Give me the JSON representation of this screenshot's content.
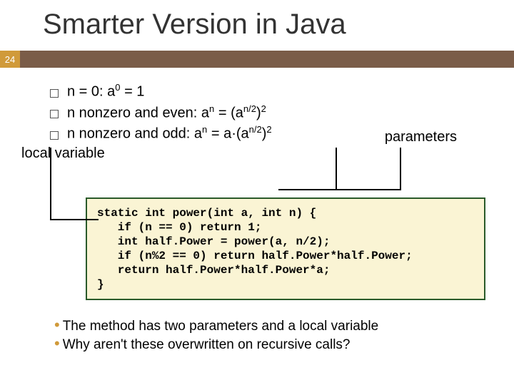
{
  "title": "Smarter Version in Java",
  "page_number": "24",
  "bullets": {
    "b1_pre": "n = 0:  a",
    "b1_sup": "0",
    "b1_post": " = 1",
    "b2_pre": "n nonzero and even:  a",
    "b2_s1": "n",
    "b2_mid": " = (a",
    "b2_s2": "n/2",
    "b2_mid2": ")",
    "b2_s3": "2",
    "b3_pre": "n nonzero and odd:  a",
    "b3_s1": "n",
    "b3_mid": " = a·(a",
    "b3_s2": "n/2",
    "b3_mid2": ")",
    "b3_s3": "2"
  },
  "labels": {
    "local": "local variable",
    "params": "parameters"
  },
  "code": "static int power(int a, int n) {\n   if (n == 0) return 1;\n   int half.Power = power(a, n/2);\n   if (n%2 == 0) return half.Power*half.Power;\n   return half.Power*half.Power*a;\n}",
  "notes": {
    "n1": "The method has two parameters and a local variable",
    "n2": "Why aren't these overwritten on recursive calls?"
  }
}
